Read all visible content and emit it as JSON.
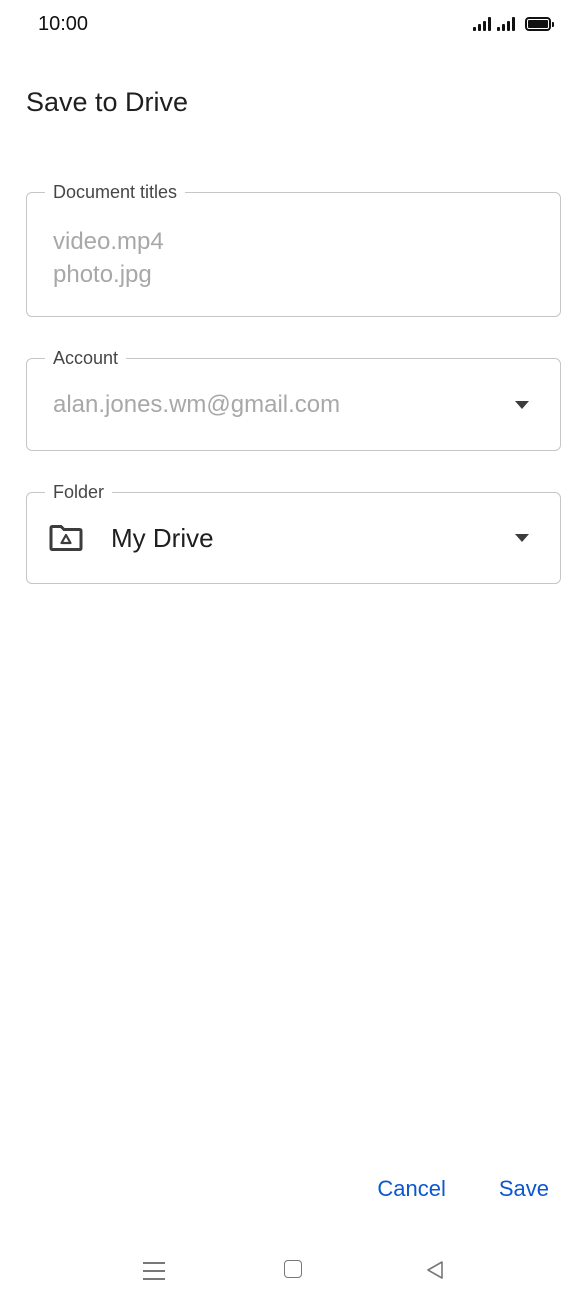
{
  "status_bar": {
    "time": "10:00"
  },
  "dialog": {
    "title": "Save to Drive"
  },
  "fields": {
    "document_titles": {
      "label": "Document titles",
      "items": [
        "video.mp4",
        "photo.jpg"
      ]
    },
    "account": {
      "label": "Account",
      "value": "alan.jones.wm@gmail.com",
      "icon": "dropdown-arrow-icon"
    },
    "folder": {
      "label": "Folder",
      "value": "My Drive",
      "icon": "drive-folder-icon"
    }
  },
  "actions": {
    "cancel_label": "Cancel",
    "save_label": "Save"
  },
  "nav": {
    "icons": [
      "menu-icon",
      "home-icon",
      "back-icon"
    ]
  },
  "colors": {
    "accent": "#0b57d0",
    "placeholder_text": "#a8a8a8",
    "outline": "#c4c7c5"
  }
}
